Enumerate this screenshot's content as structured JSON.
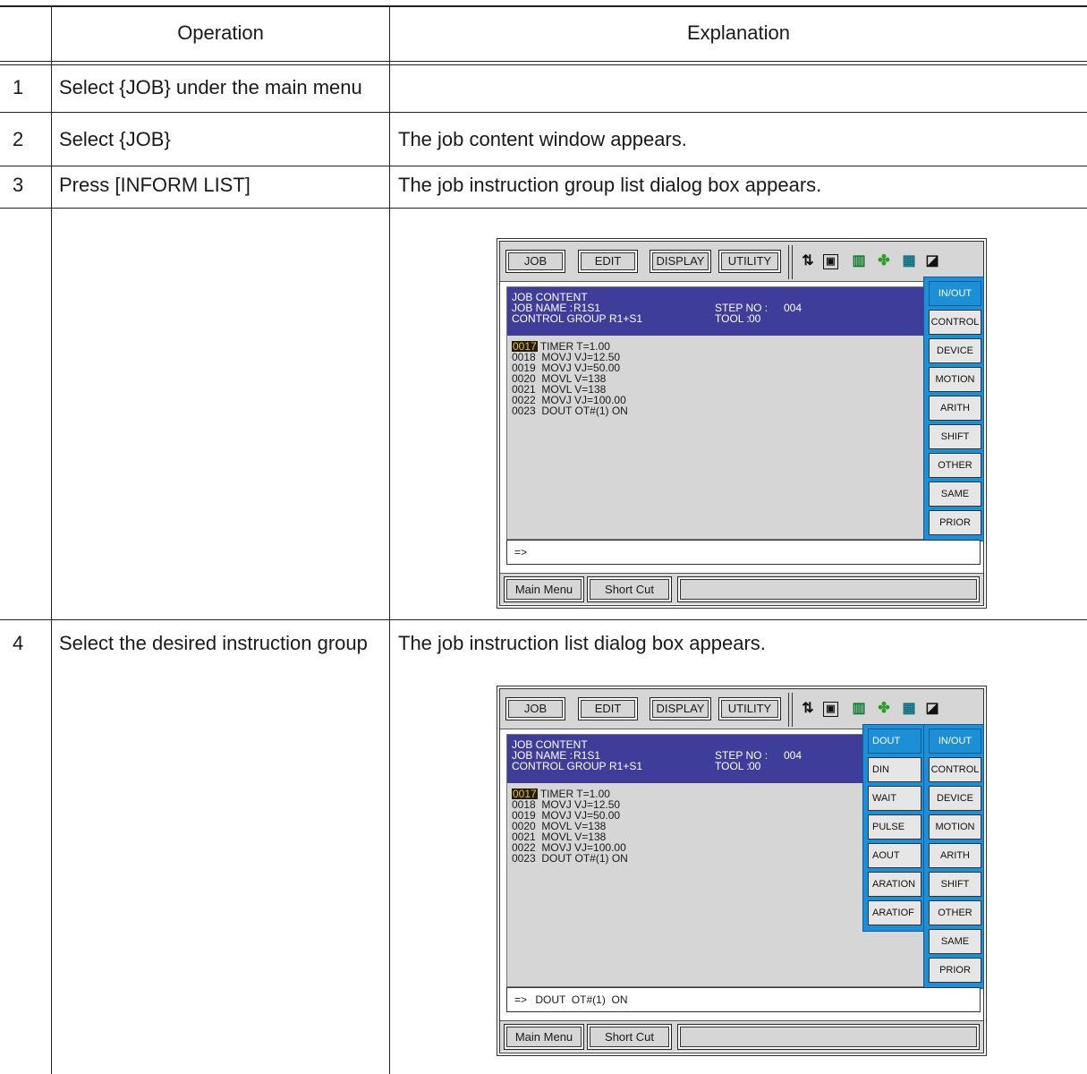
{
  "table": {
    "headers": {
      "operation": "Operation",
      "explanation": "Explanation"
    },
    "rows": [
      {
        "num": "1",
        "operation": "Select {JOB} under the main menu",
        "explanation": ""
      },
      {
        "num": "2",
        "operation": "Select {JOB}",
        "explanation": "The job content window appears."
      },
      {
        "num": "3",
        "operation": "Press [INFORM LIST]",
        "explanation": "The job instruction group list dialog box appears."
      },
      {
        "num": "4",
        "operation": "Select the desired instruction group",
        "explanation": "The job instruction list dialog box appears."
      }
    ]
  },
  "screen": {
    "menu": [
      "JOB",
      "EDIT",
      "DISPLAY",
      "UTILITY"
    ],
    "status_icons": [
      "robot-axis-icon",
      "coordinate-icon",
      "manual-speed-icon",
      "security-icon",
      "page-icon",
      "edit-lock-icon"
    ],
    "title": "JOB CONTENT",
    "job_name_label": "JOB NAME :",
    "job_name": "R1S1",
    "control_group_label": "CONTROL GROUP :",
    "control_group": "R1+S1",
    "step_no_label": "STEP NO :",
    "step_no": "004",
    "tool_label": "TOOL :",
    "tool": "00",
    "lines": [
      {
        "num": "0017",
        "text": "TIMER T=1.00"
      },
      {
        "num": "0018",
        "text": "MOVJ VJ=12.50"
      },
      {
        "num": "0019",
        "text": "MOVJ VJ=50.00"
      },
      {
        "num": "0020",
        "text": "MOVL V=138"
      },
      {
        "num": "0021",
        "text": "MOVL V=138"
      },
      {
        "num": "0022",
        "text": "MOVJ VJ=100.00"
      },
      {
        "num": "0023",
        "text": "DOUT OT#(1) ON"
      }
    ],
    "groups": [
      "IN/OUT",
      "CONTROL",
      "DEVICE",
      "MOTION",
      "ARITH",
      "SHIFT",
      "OTHER",
      "SAME",
      "PRIOR"
    ],
    "subitems": [
      "DOUT",
      "DIN",
      "WAIT",
      "PULSE",
      "AOUT",
      "ARATION",
      "ARATIOF"
    ],
    "prompt": "=>",
    "input1": "",
    "input2": "DOUT  OT#(1)  ON",
    "bottom": [
      "Main Menu",
      "Short Cut"
    ]
  }
}
